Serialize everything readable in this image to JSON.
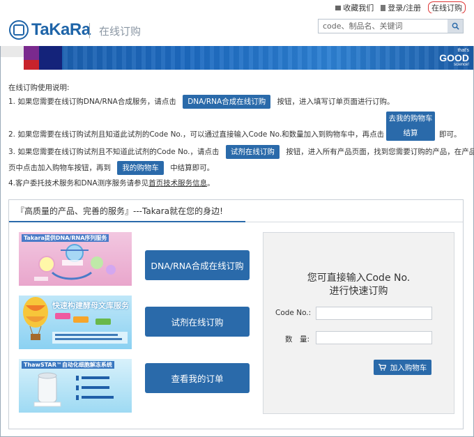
{
  "topbar": {
    "favorites": "收藏我们",
    "login": "登录/注册",
    "online_order": "在线订购"
  },
  "header": {
    "logo_text": "TaKaRa",
    "subtitle": "在线订购",
    "search_placeholder": "code、制品名、关键词"
  },
  "banner": {
    "brand_line1": "that's",
    "brand_line2": "GOOD",
    "brand_line3": "science!"
  },
  "instructions": {
    "heading": "在线订购使用说明:",
    "l1_pre": "1. 如果您需要在线订购DNA/RNA合成服务，请点击",
    "l1_btn": "DNA/RNA合成在线订购",
    "l1_post": "按钮，进入填写订单页面进行订购。",
    "l2_pre": "2. 如果您需要在线订购试剂且知道此试剂的Code No.，可以通过直接输入Code No.和数量加入到购物车中，再点击",
    "l2_btn_1": "去我的购物车",
    "l2_btn_2": "结算",
    "l2_post": "即可。",
    "l3_pre": "3. 如果您需要在线订购试剂且不知道此试剂的Code No.，请点击",
    "l3_btn": "试剂在线订购",
    "l3_post": "按钮，进入所有产品页面，找到您需要订购的产品，在产品",
    "l3b_pre": "页中点击加入购物车按钮，再到",
    "l3b_btn": "我的购物车",
    "l3b_post": "中结算即可。",
    "l4_pre": "4.客户委托技术服务和DNA测序服务请参见",
    "l4_link": "首页技术服务信息",
    "l4_post": "。"
  },
  "panel": {
    "title": "『高质量的产品、完善的服务』---Takara就在您的身边!",
    "promos": [
      {
        "title": "Takara提供DNA/RNA序列服务"
      },
      {
        "title": "快速构建酵母文库服务"
      },
      {
        "title": "ThawSTAR™自动化细胞解冻系统"
      }
    ],
    "buttons": {
      "dna_rna": "DNA/RNA合成在线订购",
      "reagent": "试剂在线订购",
      "my_orders": "查看我的订单"
    },
    "quick": {
      "line1": "您可直接输入Code No.",
      "line2": "进行快速订购",
      "code_label": "Code No.:",
      "qty_label": "数　量:",
      "cart_button": "加入购物车"
    }
  }
}
